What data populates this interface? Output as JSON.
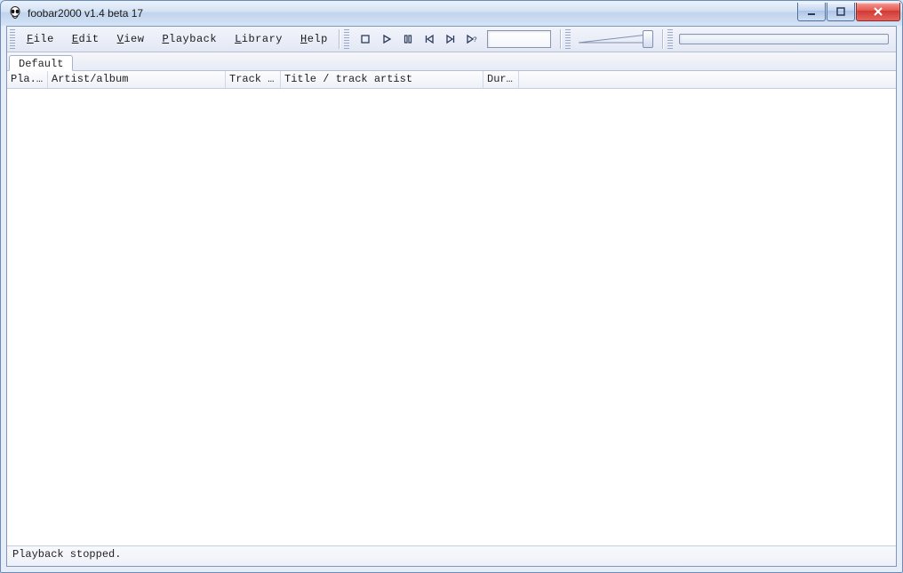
{
  "window": {
    "title": "foobar2000 v1.4 beta 17",
    "app_icon": "foobar2000-alien-icon"
  },
  "menubar": {
    "items": [
      {
        "label": "File",
        "accel": "F"
      },
      {
        "label": "Edit",
        "accel": "E"
      },
      {
        "label": "View",
        "accel": "V"
      },
      {
        "label": "Playback",
        "accel": "P"
      },
      {
        "label": "Library",
        "accel": "L"
      },
      {
        "label": "Help",
        "accel": "H"
      }
    ]
  },
  "playback_controls": {
    "stop": "Stop",
    "play": "Play",
    "pause": "Pause",
    "prev": "Previous",
    "next": "Next",
    "random": "Random"
  },
  "playback_order": {
    "display": ""
  },
  "volume": {
    "value_percent": 100
  },
  "seek": {
    "position_percent": 0
  },
  "tabs": [
    {
      "label": "Default",
      "active": true
    }
  ],
  "columns": {
    "playing": "Pla...",
    "artist": "Artist/album",
    "trackno": "Track no",
    "title": "Title / track artist",
    "duration": "Dur..."
  },
  "playlist_rows": [],
  "statusbar": {
    "text": "Playback stopped."
  },
  "window_controls": {
    "minimize": "Minimize",
    "maximize": "Maximize",
    "close": "Close"
  }
}
